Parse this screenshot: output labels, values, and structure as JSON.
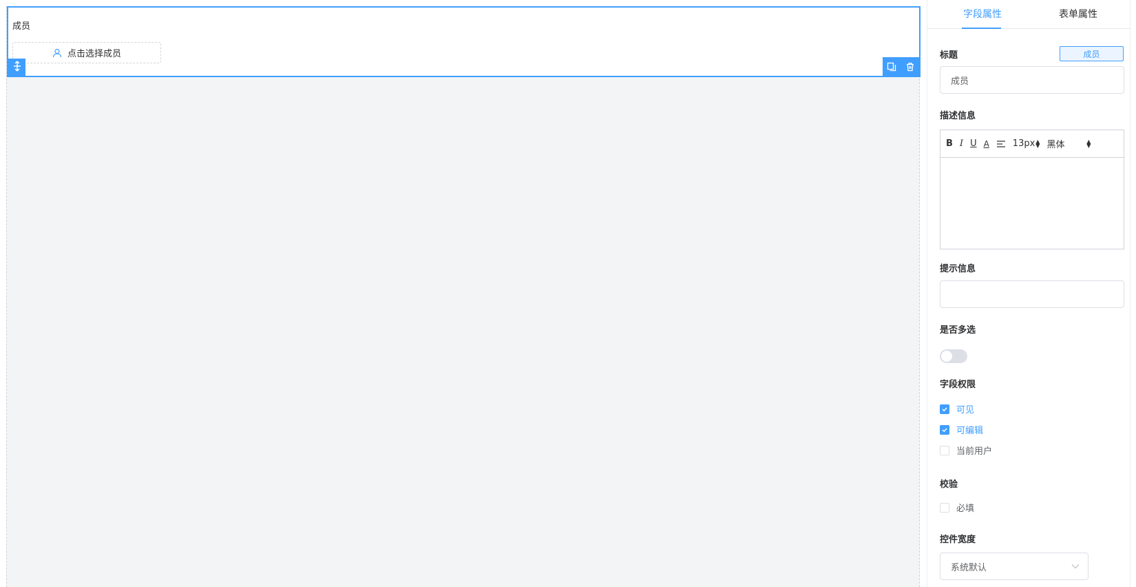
{
  "canvas": {
    "field": {
      "label": "成员",
      "picker_text": "点击选择成员"
    }
  },
  "panel": {
    "tabs": [
      {
        "label": "字段属性",
        "active": true
      },
      {
        "label": "表单属性",
        "active": false
      }
    ],
    "title_section": {
      "label": "标题",
      "tag": "成员",
      "value": "成员"
    },
    "description_section": {
      "label": "描述信息",
      "toolbar": {
        "bold": "B",
        "italic": "I",
        "underline": "U",
        "color": "A",
        "font_size": "13px",
        "font_family": "黑体"
      }
    },
    "hint_section": {
      "label": "提示信息",
      "value": ""
    },
    "multi_section": {
      "label": "是否多选",
      "enabled": false
    },
    "permission_section": {
      "label": "字段权限",
      "options": [
        {
          "label": "可见",
          "checked": true
        },
        {
          "label": "可编辑",
          "checked": true
        },
        {
          "label": "当前用户",
          "checked": false
        }
      ]
    },
    "validation_section": {
      "label": "校验",
      "options": [
        {
          "label": "必填",
          "checked": false
        }
      ]
    },
    "width_section": {
      "label": "控件宽度",
      "value": "系统默认"
    }
  },
  "colors": {
    "accent": "#409eff",
    "canvas_bg": "#f3f4f6",
    "border": "#dcdfe6"
  }
}
